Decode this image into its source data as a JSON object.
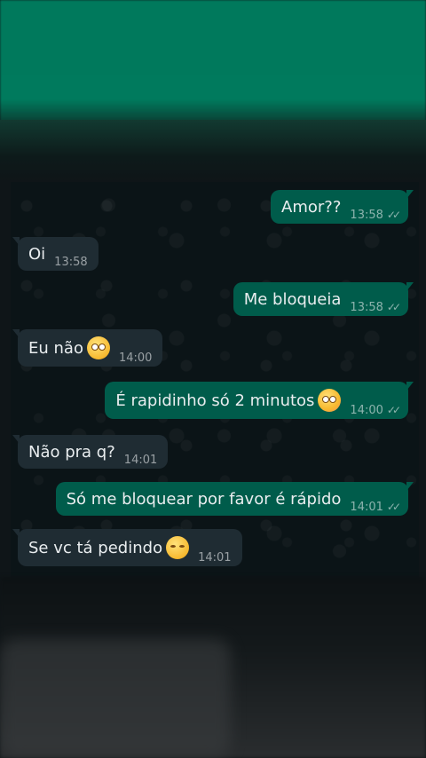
{
  "messages": [
    {
      "text": "Amor??",
      "time": "13:58",
      "dir": "out",
      "emoji": ""
    },
    {
      "text": "Oi",
      "time": "13:58",
      "dir": "in",
      "emoji": ""
    },
    {
      "text": "Me bloqueia",
      "time": "13:58",
      "dir": "out",
      "emoji": ""
    },
    {
      "text": "Eu não",
      "time": "14:00",
      "dir": "in",
      "emoji": "eye-roll-emoji-icon"
    },
    {
      "text": "É rapidinho só 2 minutos",
      "time": "14:00",
      "dir": "out",
      "emoji": "flushed-emoji-icon"
    },
    {
      "text": "Não pra q?",
      "time": "14:01",
      "dir": "in",
      "emoji": ""
    },
    {
      "text": "Só me bloquear por favor é rápido",
      "time": "14:01",
      "dir": "out",
      "emoji": ""
    },
    {
      "text": "Se vc tá pedindo",
      "time": "14:01",
      "dir": "in",
      "emoji": "kissing-emoji-icon"
    }
  ],
  "colors": {
    "header": "#007a5d",
    "outgoing_bubble": "#005c4b",
    "incoming_bubble": "#1f2c33",
    "chat_bg": "#0b1417"
  },
  "icons": {
    "read_receipt": "double-check-icon"
  }
}
